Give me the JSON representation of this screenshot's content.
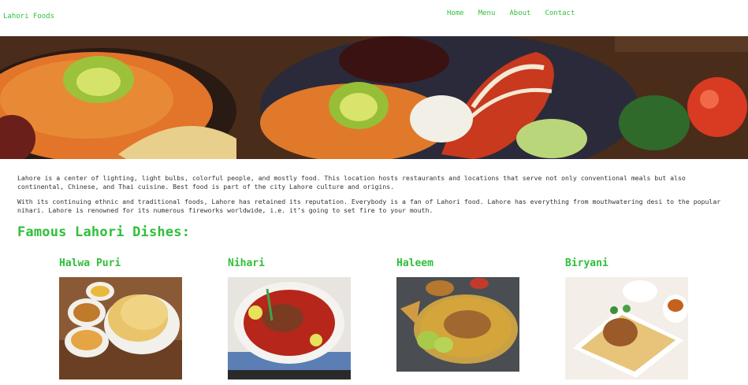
{
  "nav": {
    "brand": "Lahori Foods",
    "links": [
      "Home",
      "Menu",
      "About",
      "Contact"
    ]
  },
  "intro": {
    "paragraph1": "Lahore is a center of lighting, light bulbs, colorful people, and mostly food. This location hosts restaurants and locations that serve not only conventional meals but also continental, Chinese, and Thai cuisine. Best food is part of the city Lahore culture and origins.",
    "paragraph2": "With its continuing ethnic and traditional foods, Lahore has retained its reputation. Everybody is a fan of Lahori food. Lahore has everything from mouthwatering desi to the popular nihari. Lahore is renowned for its numerous fireworks worldwide, i.e. it’s going to set fire to your mouth."
  },
  "section": {
    "title": "Famous Lahori Dishes:"
  },
  "dishes": [
    {
      "name": "Halwa Puri"
    },
    {
      "name": "Nihari"
    },
    {
      "name": "Haleem"
    },
    {
      "name": "Biryani"
    }
  ],
  "colors": {
    "accent": "#2fbf3a",
    "text": "#333333",
    "background": "#ffffff"
  }
}
